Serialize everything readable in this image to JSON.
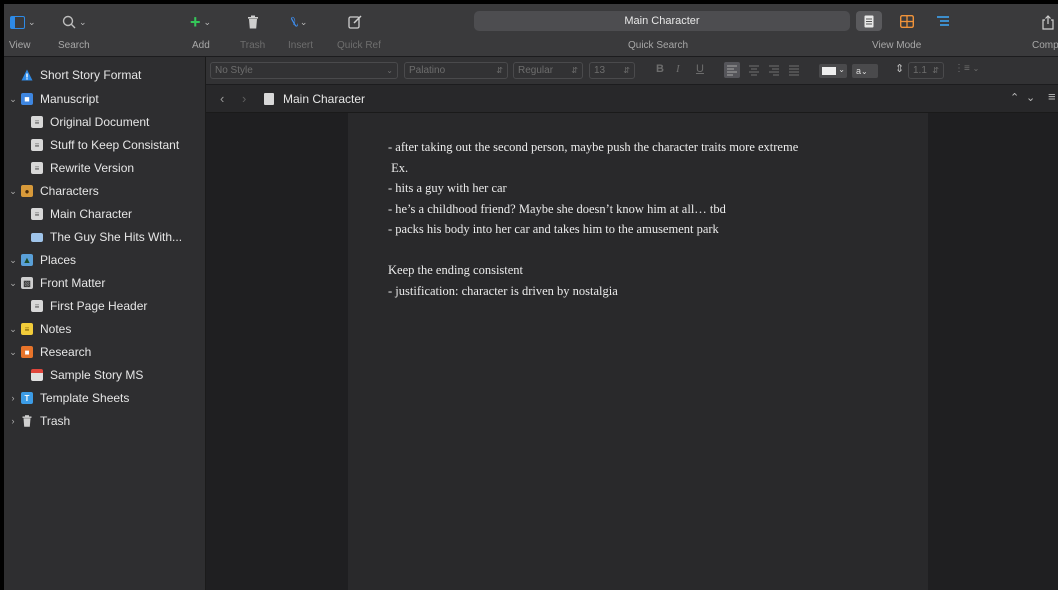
{
  "toolbar": {
    "view_label": "View",
    "search_label": "Search",
    "add_label": "Add",
    "trash_label": "Trash",
    "insert_label": "Insert",
    "quickref_label": "Quick Ref",
    "quicksearch_value": "Main Character",
    "quicksearch_label": "Quick Search",
    "viewmode_label": "View Mode",
    "compile_label": "Comp"
  },
  "formatbar": {
    "style": "No Style",
    "font": "Palatino",
    "weight": "Regular",
    "size": "13",
    "bold": "B",
    "italic": "I",
    "underline": "U",
    "line_spacing": "1.1",
    "highlight": "a"
  },
  "binder": {
    "items": [
      {
        "label": "Short Story Format",
        "icon": "info-icon"
      },
      {
        "label": "Manuscript",
        "icon": "manuscript-icon"
      },
      {
        "label": "Original Document",
        "icon": "document-icon"
      },
      {
        "label": "Stuff to Keep Consistant",
        "icon": "document-icon"
      },
      {
        "label": "Rewrite Version",
        "icon": "document-icon"
      },
      {
        "label": "Characters",
        "icon": "characters-folder-icon"
      },
      {
        "label": "Main Character",
        "icon": "document-icon"
      },
      {
        "label": "The Guy She Hits With...",
        "icon": "image-doc-icon"
      },
      {
        "label": "Places",
        "icon": "places-folder-icon"
      },
      {
        "label": "Front Matter",
        "icon": "front-matter-folder-icon"
      },
      {
        "label": "First Page Header",
        "icon": "document-icon"
      },
      {
        "label": "Notes",
        "icon": "notes-folder-icon"
      },
      {
        "label": "Research",
        "icon": "research-folder-icon"
      },
      {
        "label": "Sample Story MS",
        "icon": "pdf-doc-icon"
      },
      {
        "label": "Template Sheets",
        "icon": "template-folder-icon"
      },
      {
        "label": "Trash",
        "icon": "trash-icon"
      }
    ]
  },
  "header": {
    "title": "Main Character"
  },
  "editor": {
    "lines": [
      "- after taking out the second person, maybe push the character traits more extreme",
      " Ex.",
      "- hits a guy with her car",
      "- he’s a childhood friend? Maybe she doesn’t know him at all… tbd",
      "- packs his body into her car and takes him to the amusement park",
      "",
      "Keep the ending consistent",
      "- justification: character is driven by nostalgia"
    ]
  },
  "colors": {
    "accent_blue": "#2e8ae6",
    "add_green": "#34c759",
    "corkboard_orange": "#f0933a",
    "outline_blue": "#3ea4f0"
  }
}
